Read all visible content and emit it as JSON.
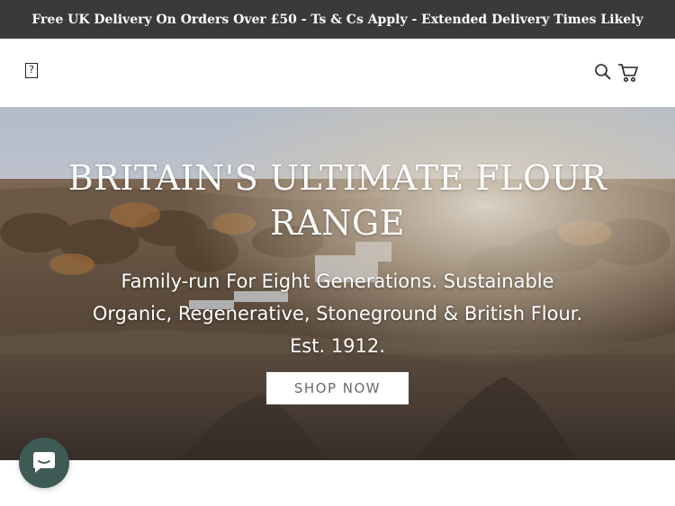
{
  "announcement": {
    "text": "Free UK Delivery On Orders Over £50 - Ts & Cs Apply - Extended Delivery Times Likely"
  },
  "header": {
    "menu_glyph": "?"
  },
  "hero": {
    "title": "BRITAIN'S ULTIMATE FLOUR RANGE",
    "subtitle": "Family-run For Eight Generations. Sustainable Organic, Regenerative, Stoneground & British Flour. Est. 1912.",
    "cta_label": "SHOP NOW"
  },
  "icons": {
    "menu": "broken-image-icon",
    "search": "search-icon",
    "cart": "cart-icon",
    "chat": "chat-icon"
  },
  "colors": {
    "announcement_bg": "#3a3a3a",
    "chat_button": "#3e5a55"
  }
}
